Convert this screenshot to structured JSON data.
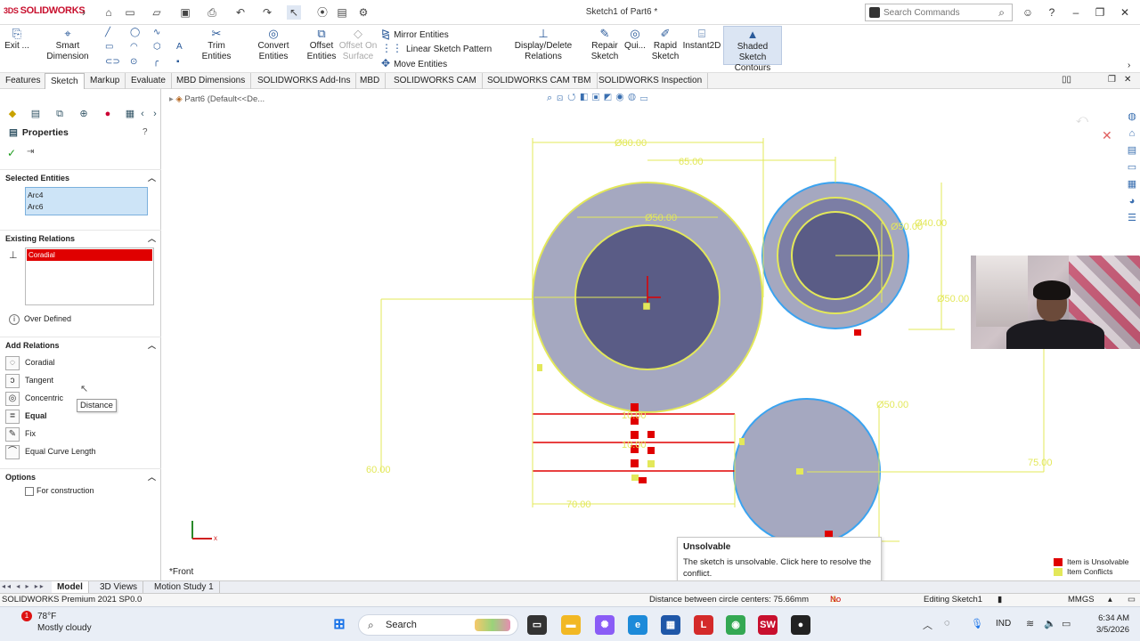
{
  "app": {
    "logo_text": "SOLIDWORKS",
    "doc_title": "Sketch1 of Part6 *",
    "search_placeholder": "Search Commands"
  },
  "commands": {
    "exit": "Exit ...",
    "smart_dimension": "Smart Dimension",
    "trim": "Trim Entities",
    "convert": "Convert Entities",
    "offset": "Offset Entities",
    "offset_surface": "Offset On Surface",
    "mirror": "Mirror Entities",
    "linear_pattern": "Linear Sketch Pattern",
    "move": "Move Entities",
    "display_delete": "Display/Delete Relations",
    "repair": "Repair Sketch",
    "quick": "Qui...",
    "rapid": "Rapid Sketch",
    "instant2d": "Instant2D",
    "shaded": "Shaded Sketch Contours"
  },
  "tabs": [
    "Features",
    "Sketch",
    "Markup",
    "Evaluate",
    "MBD Dimensions",
    "SOLIDWORKS Add-Ins",
    "MBD",
    "SOLIDWORKS CAM",
    "SOLIDWORKS CAM TBM",
    "SOLIDWORKS Inspection"
  ],
  "active_tab": "Sketch",
  "breadcrumb": "Part6 (Default<<De...",
  "panel": {
    "title": "Properties",
    "selected_entities_label": "Selected Entities",
    "selected_entities": [
      "Arc4",
      "Arc6"
    ],
    "existing_relations_label": "Existing Relations",
    "existing_relation_item": "Coradial",
    "status": "Over Defined",
    "add_relations_label": "Add Relations",
    "add_relations": [
      "Coradial",
      "Tangent",
      "Concentric",
      "Equal",
      "Fix",
      "Equal Curve Length"
    ],
    "options_label": "Options",
    "for_construction": "For construction"
  },
  "tooltip": "Distance",
  "dimensions": {
    "d80": "Ø80.00",
    "d65": "65.00",
    "d50a": "Ø50.00",
    "d40": "Ø40.00",
    "d50b": "Ø50.00",
    "d50c": "Ø50.00",
    "d60": "60.00",
    "d70": "70.00",
    "d75": "75.00",
    "d10a": "10.00",
    "d10b": "10.00",
    "view": "*Front"
  },
  "unsolvable": {
    "title": "Unsolvable",
    "body": "The sketch is unsolvable. Click here to resolve the conflict."
  },
  "legend": {
    "item1": "Item is Unsolvable",
    "item2": "Item Conflicts"
  },
  "bottom_tabs": [
    "Model",
    "3D Views",
    "Motion Study 1"
  ],
  "status": {
    "product": "SOLIDWORKS Premium 2021 SP0.0",
    "distance": "Distance between circle centers: 75.66mm",
    "solution": "No Solution Found",
    "editing": "Editing Sketch1",
    "units": "MMGS"
  },
  "taskbar": {
    "temp": "78°F",
    "weather": "Mostly cloudy",
    "badge": "1",
    "search": "Search",
    "lang": "IND",
    "time": "6:34 AM",
    "date": "3/5/2026"
  },
  "colors": {
    "sketch_yellow": "#e3e85a",
    "circle_fill": "#a5a8c0",
    "inner_fill": "#5a5c86",
    "conflict_red": "#e00000",
    "highlight_blue": "#3aa3f0"
  }
}
